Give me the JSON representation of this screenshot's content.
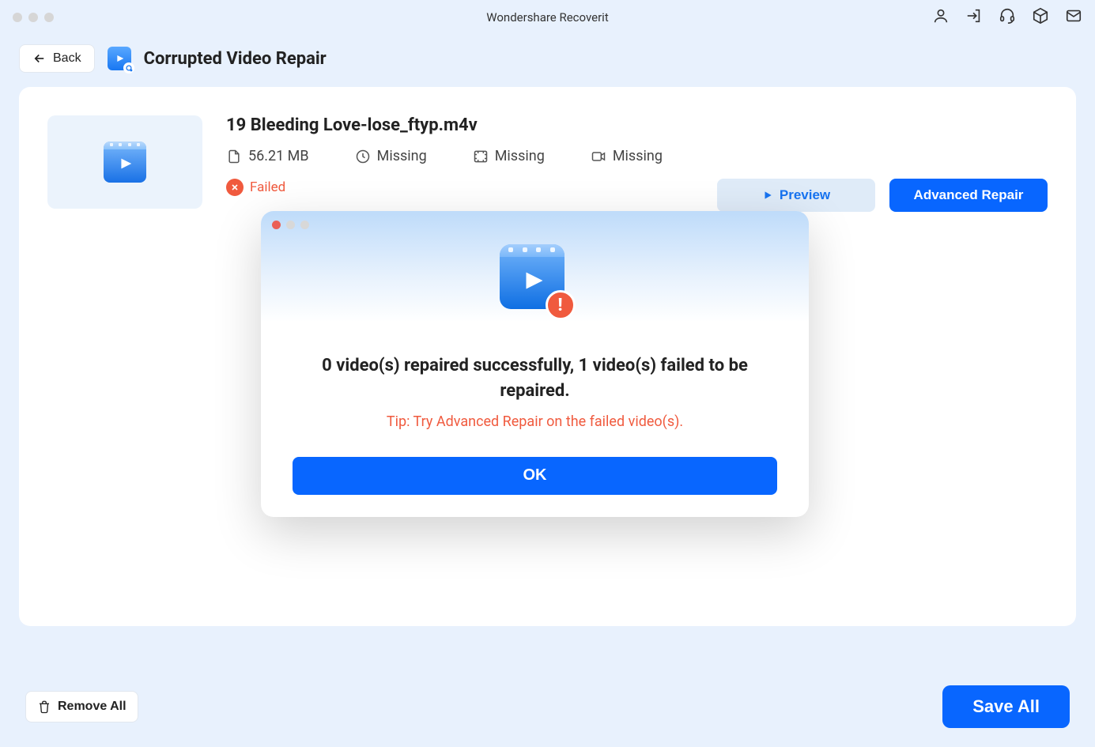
{
  "titlebar": {
    "title": "Wondershare Recoverit"
  },
  "subheader": {
    "back_label": "Back",
    "page_title": "Corrupted Video Repair"
  },
  "video": {
    "name": "19 Bleeding Love-lose_ftyp.m4v",
    "size": "56.21 MB",
    "duration": "Missing",
    "resolution": "Missing",
    "codec": "Missing",
    "status_label": "Failed"
  },
  "actions": {
    "preview_label": "Preview",
    "advanced_repair_label": "Advanced Repair"
  },
  "footer": {
    "remove_all_label": "Remove All",
    "save_all_label": "Save All"
  },
  "modal": {
    "message": "0 video(s) repaired successfully, 1 video(s) failed to be repaired.",
    "tip": "Tip: Try Advanced Repair on the failed video(s).",
    "ok_label": "OK"
  }
}
